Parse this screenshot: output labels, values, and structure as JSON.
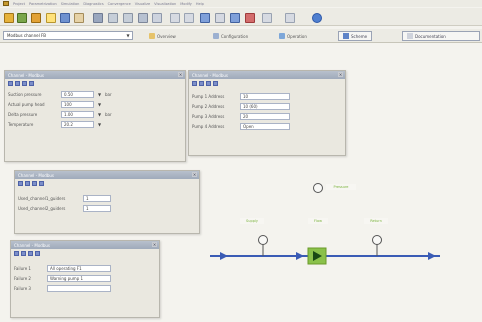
{
  "menubar": {
    "items": [
      "Project",
      "Parametrization",
      "Simulation",
      "Diagnostics",
      "Convergence",
      "Visualize",
      "Visualization",
      "Modify",
      "Help"
    ]
  },
  "toolbar2": {
    "project_value": "Modbus channel FB",
    "tabs": [
      "Overview",
      "Configuration",
      "Operation"
    ],
    "tab_active": "Scheme",
    "tab_last": "Documentation"
  },
  "window_params": {
    "title": "Channel - Modbus",
    "rows": [
      {
        "label": "Suction pressure",
        "value": "0.50",
        "unit": "bar"
      },
      {
        "label": "Actual pump head",
        "value": "100",
        "unit": ""
      },
      {
        "label": "Delta pressure",
        "value": "1.00",
        "unit": "bar"
      },
      {
        "label": "Temperature",
        "value": "20.2",
        "unit": ""
      }
    ]
  },
  "window_pumps": {
    "title": "Channel - Modbus",
    "rows": [
      {
        "label": "Pump 1 Address",
        "value": "10"
      },
      {
        "label": "Pump 2 Address",
        "value": "10 (60)"
      },
      {
        "label": "Pump 3 Address",
        "value": "20"
      },
      {
        "label": "Pump 4 Address",
        "value": "Open"
      }
    ]
  },
  "window_channels": {
    "title": "Channel - Modbus",
    "rows": [
      {
        "label": "Used_channel1_guiders",
        "value": "1"
      },
      {
        "label": "Used_channel2_guiders",
        "value": "1"
      }
    ]
  },
  "window_failures": {
    "title": "Channel - Modbus",
    "rows": [
      {
        "label": "Failure 1",
        "value": "All operating F1"
      },
      {
        "label": "Failure 2",
        "value": "Warning pump 1"
      },
      {
        "label": "Failure 3",
        "value": ""
      }
    ]
  },
  "scheme": {
    "labels": {
      "pressure": "Pressure",
      "flow": "Flow",
      "pump_label": "Pump",
      "left": "Supply",
      "right": "Return"
    },
    "colors": {
      "pipe": "#3a5bb5",
      "label": "#8ac14a",
      "pump": "#1a4a14"
    }
  }
}
